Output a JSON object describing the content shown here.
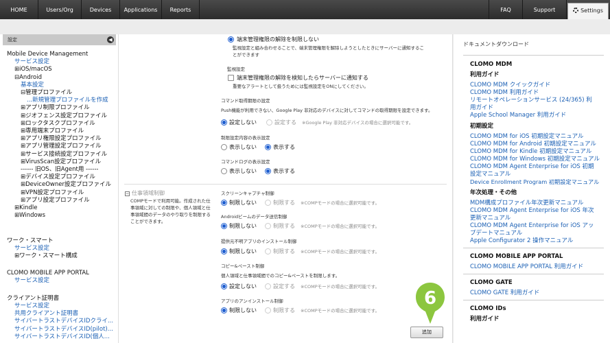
{
  "topnav": {
    "left": [
      "HOME",
      "Users/Org",
      "Devices",
      "Applications",
      "Reports"
    ],
    "faq": "FAQ",
    "support": "Support",
    "settings": "Settings"
  },
  "sidebar": {
    "header": "設定",
    "items": [
      "Mobile Device Management",
      "サービス設定",
      "⊞iOS/macOS",
      "⊟Android",
      "基本設定",
      "⊟管理プロファイル",
      "...新規管理プロファイルを作成",
      "⊞アプリ制限プロファイル",
      "⊞ジオフェンス設定プロファイル",
      "⊞ロックタスクプロファイル",
      "⊞専用端末プロファイル",
      "⊞アプリ権限設定プロファイル",
      "⊞アプリ管理設定プロファイル",
      "⊞サービス接続設定プロファイル",
      "⊞VirusScan設定プロファイル",
      "------ 旧OS、旧Agent用 ------",
      "⊞デバイス設定プロファイル",
      "⊞DeviceOwner設定プロファイル",
      "⊞VPN設定プロファイル",
      "⊞アプリ設定プロファイル",
      "⊞Kindle",
      "⊞Windows",
      "ワーク・スマート",
      "サービス設定",
      "⊞ワーク・スマート構成",
      "CLOMO MOBILE APP PORTAL",
      "サービス設定",
      "クライアント証明書",
      "サービス設定",
      "共用クライアント証明書",
      "サイバートラストデバイスIDクライ...",
      "サイバートラストデバイスID(pilot)...",
      "サイバートラストデバイスID(個人..."
    ]
  },
  "main": {
    "top_option": "端末管理権限の解除を制限しない",
    "top_desc_1": "監視設定と組み合わせることで、端末管理権限を解除しようとしたときにサーバーに通知するこ",
    "top_desc_2": "とができます",
    "monitor_label": "監視設定",
    "monitor_check": "端末管理権限の解除を検知したらサーバーに通知する",
    "monitor_desc": "重要なアラートとして扱うためには監視設定をONにしてください。",
    "cmd_period_label": "コマンド取得期限の設定",
    "cmd_period_desc": "Push機能が利用できない、Google Play 非対応のデバイスに対してコマンドの取得期限を設定できます。",
    "cmd_period_off": "設定しない",
    "cmd_period_on": "設定する",
    "cmd_period_note": "※Google Play 非対応デバイスの場合に選択可能です。",
    "restrict_display_label": "制限設定内容の表示設定",
    "hide": "表示しない",
    "show": "表示する",
    "cmdlog_label": "コマンドログの表示設定",
    "work_section": "仕事領域制御",
    "work_desc": [
      "COMPモードで利用可能。作成された仕",
      "事領域に対しての制限や、個人領域と仕",
      "事領域間のデータのやり取りを制限する",
      "ことができます。"
    ],
    "restrict_off": "制限しない",
    "restrict_on": "制限する",
    "comp_note": "※COMPモードの場合に選択可能です。",
    "screenshot_label": "スクリーンキャプチャ制御",
    "beam_label": "Androidビームのデータ送信制御",
    "unknown_label": "提供元不明アプリのインストール制御",
    "copy_label": "コピー&ペースト制御",
    "copy_desc": "個人領域と仕事領域間でのコピー&ペーストを制限します。",
    "setting_off": "設定しない",
    "setting_on": "設定する",
    "uninstall_label": "アプリのアンインストール制御",
    "add_button": "追加",
    "callout_number": "6"
  },
  "rpanel": {
    "title": "ドキュメントダウンロード",
    "items": [
      {
        "k": "h",
        "t": "CLOMO MDM"
      },
      {
        "k": "h",
        "t": "利用ガイド"
      },
      {
        "k": "l",
        "t": "CLOMO MDM クイックガイド"
      },
      {
        "k": "l",
        "t": "CLOMO MDM 利用ガイド"
      },
      {
        "k": "l",
        "t": "リモートオペレーションサービス (24/365) 利"
      },
      {
        "k": "l",
        "t": "用ガイド"
      },
      {
        "k": "l",
        "t": "Apple School Manager 利用ガイド"
      },
      {
        "k": "h",
        "t": "初期設定"
      },
      {
        "k": "l",
        "t": "CLOMO MDM for iOS 初期設定マニュアル"
      },
      {
        "k": "l",
        "t": "CLOMO MDM for Android 初期設定マニュアル"
      },
      {
        "k": "l",
        "t": "CLOMO MDM for Kindle 初期設定マニュアル"
      },
      {
        "k": "l",
        "t": "CLOMO MDM for Windows 初期設定マニュアル"
      },
      {
        "k": "l",
        "t": "CLOMO MDM Agent Enterprise for iOS 初期"
      },
      {
        "k": "l",
        "t": "設定マニュアル"
      },
      {
        "k": "l",
        "t": "Device Enrollment Program 初期設定マニュアル"
      },
      {
        "k": "h",
        "t": "年次処理・その他"
      },
      {
        "k": "l",
        "t": "MDM構成プロファイル年次更新マニュアル"
      },
      {
        "k": "l",
        "t": "CLOMO MDM Agent Enterprise for iOS 年次"
      },
      {
        "k": "l",
        "t": "更新マニュアル"
      },
      {
        "k": "l",
        "t": "CLOMO MDM Agent Enterprise for iOS アッ"
      },
      {
        "k": "l",
        "t": "プデートマニュアル"
      },
      {
        "k": "l",
        "t": "Apple Configurator 2 操作マニュアル"
      },
      {
        "k": "h",
        "t": "CLOMO MOBILE APP PORTAL"
      },
      {
        "k": "l",
        "t": "CLOMO MOBILE APP PORTAL 利用ガイド"
      },
      {
        "k": "h",
        "t": "CLOMO GATE"
      },
      {
        "k": "l",
        "t": "CLOMO GATE 利用ガイド"
      },
      {
        "k": "h",
        "t": "CLOMO IDs"
      },
      {
        "k": "h",
        "t": "利用ガイド"
      }
    ]
  },
  "colors": {
    "accent": "#1f5fd0",
    "callout": "#8cc63f",
    "link": "#1a5fb4"
  }
}
